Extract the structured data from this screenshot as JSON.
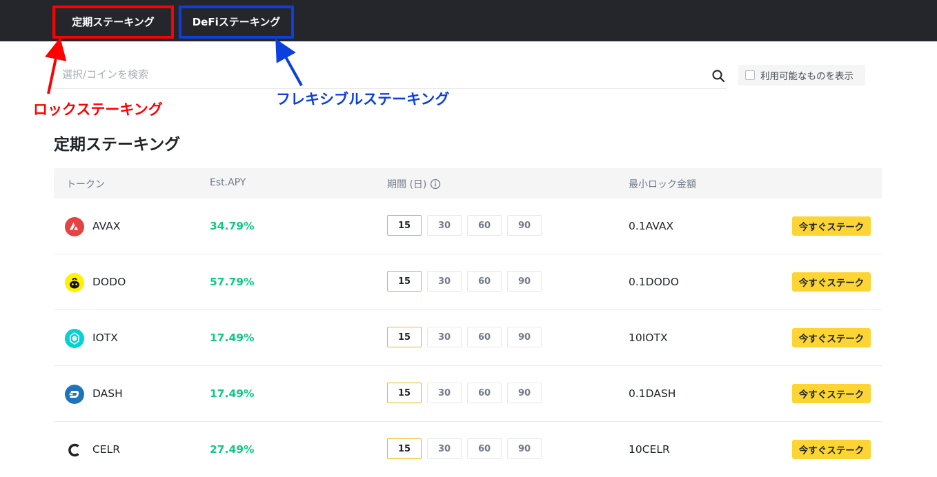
{
  "tabs": {
    "fixed_label": "定期ステーキング",
    "defi_label": "DeFiステーキング"
  },
  "annotations": {
    "red_label": "ロックステーキング",
    "blue_label": "フレキシブルステーキング",
    "red_color": "#ff0000",
    "blue_color": "#0b3fe0"
  },
  "search": {
    "placeholder": "選択/コインを検索",
    "icon": "search-icon"
  },
  "filter": {
    "label": "利用可能なものを表示",
    "checked": false
  },
  "section": {
    "title": "定期ステーキング"
  },
  "table": {
    "headers": {
      "token": "トークン",
      "apy": "Est.APY",
      "duration": "期間 (日)",
      "min_lock": "最小ロック金額"
    },
    "rows": [
      {
        "coin": "AVAX",
        "icon": "avax-icon",
        "apy": "34.79%",
        "durations": [
          "15",
          "30",
          "60",
          "90"
        ],
        "selected": "15",
        "min": "0.1AVAX",
        "action": "今すぐステーク"
      },
      {
        "coin": "DODO",
        "icon": "dodo-icon",
        "apy": "57.79%",
        "durations": [
          "15",
          "30",
          "60",
          "90"
        ],
        "selected": "15",
        "min": "0.1DODO",
        "action": "今すぐステーク"
      },
      {
        "coin": "IOTX",
        "icon": "iotx-icon",
        "apy": "17.49%",
        "durations": [
          "15",
          "30",
          "60",
          "90"
        ],
        "selected": "15",
        "min": "10IOTX",
        "action": "今すぐステーク"
      },
      {
        "coin": "DASH",
        "icon": "dash-icon",
        "apy": "17.49%",
        "durations": [
          "15",
          "30",
          "60",
          "90"
        ],
        "selected": "15",
        "min": "0.1DASH",
        "action": "今すぐステーク"
      },
      {
        "coin": "CELR",
        "icon": "celr-icon",
        "apy": "27.49%",
        "durations": [
          "15",
          "30",
          "60",
          "90"
        ],
        "selected": "15",
        "min": "10CELR",
        "action": "今すぐステーク"
      }
    ]
  },
  "colors": {
    "topbar": "#24262b",
    "apy_green": "#0ecb81",
    "accent_yellow": "#fcd535",
    "selected_border": "#f0b90b"
  }
}
